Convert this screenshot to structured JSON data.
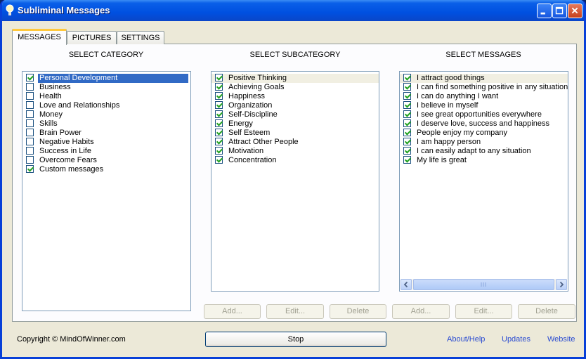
{
  "window": {
    "title": "Subliminal Messages"
  },
  "tabs": [
    {
      "label": "MESSAGES",
      "active": true
    },
    {
      "label": "PICTURES",
      "active": false
    },
    {
      "label": "SETTINGS",
      "active": false
    }
  ],
  "headers": {
    "category": "SELECT CATEGORY",
    "subcategory": "SELECT SUBCATEGORY",
    "messages": "SELECT MESSAGES"
  },
  "categories": [
    {
      "label": "Personal Development",
      "checked": true,
      "selected": true
    },
    {
      "label": "Business",
      "checked": false
    },
    {
      "label": "Health",
      "checked": false
    },
    {
      "label": "Love and Relationships",
      "checked": false
    },
    {
      "label": "Money",
      "checked": false
    },
    {
      "label": "Skills",
      "checked": false
    },
    {
      "label": "Brain Power",
      "checked": false
    },
    {
      "label": "Negative Habits",
      "checked": false
    },
    {
      "label": "Success in Life",
      "checked": false
    },
    {
      "label": "Overcome Fears",
      "checked": false
    },
    {
      "label": "Custom messages",
      "checked": true
    }
  ],
  "subcategories": [
    {
      "label": "Positive Thinking",
      "checked": true,
      "highlighted": true
    },
    {
      "label": "Achieving Goals",
      "checked": true
    },
    {
      "label": "Happiness",
      "checked": true
    },
    {
      "label": "Organization",
      "checked": true
    },
    {
      "label": "Self-Discipline",
      "checked": true
    },
    {
      "label": "Energy",
      "checked": true
    },
    {
      "label": "Self Esteem",
      "checked": true
    },
    {
      "label": "Attract Other People",
      "checked": true
    },
    {
      "label": "Motivation",
      "checked": true
    },
    {
      "label": "Concentration",
      "checked": true
    }
  ],
  "messages": [
    {
      "label": "I attract good things",
      "checked": true,
      "highlighted": true
    },
    {
      "label": "I can find something positive in any situation",
      "checked": true
    },
    {
      "label": "I can do anything I want",
      "checked": true
    },
    {
      "label": "I believe in myself",
      "checked": true
    },
    {
      "label": "I see great opportunities everywhere",
      "checked": true
    },
    {
      "label": "I deserve love, success and happiness",
      "checked": true
    },
    {
      "label": "People enjoy my company",
      "checked": true
    },
    {
      "label": "I am happy person",
      "checked": true
    },
    {
      "label": "I can easily adapt to any situation",
      "checked": true
    },
    {
      "label": "My life is great",
      "checked": true
    }
  ],
  "buttons": {
    "add": "Add...",
    "edit": "Edit...",
    "delete": "Delete",
    "stop": "Stop"
  },
  "footer": {
    "copyright": "Copyright © MindOfWinner.com",
    "about": "About/Help",
    "updates": "Updates",
    "website": "Website"
  },
  "colors": {
    "titlebar": "#0050e0",
    "selection": "#316ac5",
    "checkmark": "#21a121",
    "link": "#2a4bd1"
  }
}
